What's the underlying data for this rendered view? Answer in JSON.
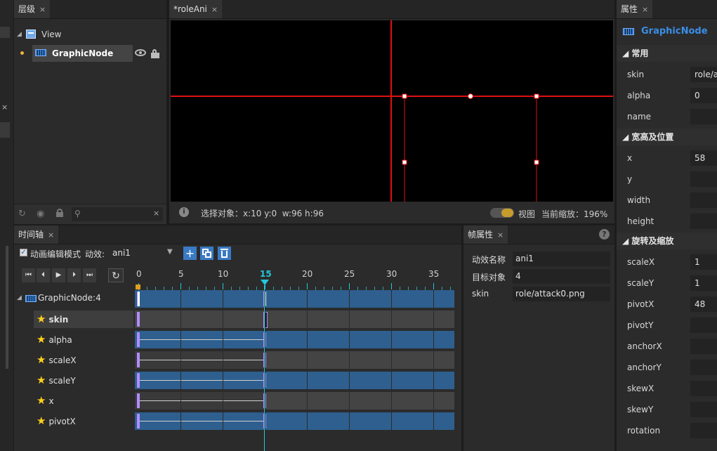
{
  "hierarchy": {
    "tab": "层级",
    "close": "×",
    "root": "View",
    "node": "GraphicNode"
  },
  "scene": {
    "tab": "*roleAni",
    "close": "×",
    "status": "选择对象：x:10 y:0  w:96 h:96",
    "view_label": "视图",
    "zoom_label": "当前缩放：196%"
  },
  "properties": {
    "tab": "属性",
    "close": "×",
    "node": "GraphicNode",
    "sections": {
      "common": "常用",
      "size_pos": "宽高及位置",
      "rot_scale": "旋转及缩放"
    },
    "common": [
      {
        "label": "skin",
        "value": "role/att"
      },
      {
        "label": "alpha",
        "value": "0"
      },
      {
        "label": "name",
        "value": ""
      }
    ],
    "size_pos": [
      {
        "label": "x",
        "value": "58"
      },
      {
        "label": "y",
        "value": ""
      },
      {
        "label": "width",
        "value": ""
      },
      {
        "label": "height",
        "value": ""
      }
    ],
    "rot_scale": [
      {
        "label": "scaleX",
        "value": "1"
      },
      {
        "label": "scaleY",
        "value": "1"
      },
      {
        "label": "pivotX",
        "value": "48"
      },
      {
        "label": "pivotY",
        "value": ""
      },
      {
        "label": "anchorX",
        "value": ""
      },
      {
        "label": "anchorY",
        "value": ""
      },
      {
        "label": "skewX",
        "value": ""
      },
      {
        "label": "skewY",
        "value": ""
      },
      {
        "label": "rotation",
        "value": ""
      }
    ]
  },
  "timeline": {
    "tab": "时间轴",
    "close": "×",
    "mode_label": "动画编辑模式",
    "anim_label": "动效:",
    "anim_value": "ani1",
    "ticks": [
      "0",
      "5",
      "10",
      "15",
      "20",
      "25",
      "30",
      "35"
    ],
    "current_frame": "15",
    "node_label": "GraphicNode:4",
    "tracks": [
      "skin",
      "alpha",
      "scaleX",
      "scaleY",
      "x",
      "pivotX"
    ]
  },
  "frame_props": {
    "tab": "帧属性",
    "close": "×",
    "help": "?",
    "rows": [
      {
        "label": "动效名称",
        "value": "ani1"
      },
      {
        "label": "目标对象",
        "value": "4"
      },
      {
        "label": "skin",
        "value": "role/attack0.png"
      }
    ]
  },
  "colors": {
    "accent": "#3a8ee6",
    "guide_red": "#e01010",
    "playhead": "#22c8d8",
    "keyframe": "#b38bff",
    "track_blue": "#2e5f8f"
  }
}
